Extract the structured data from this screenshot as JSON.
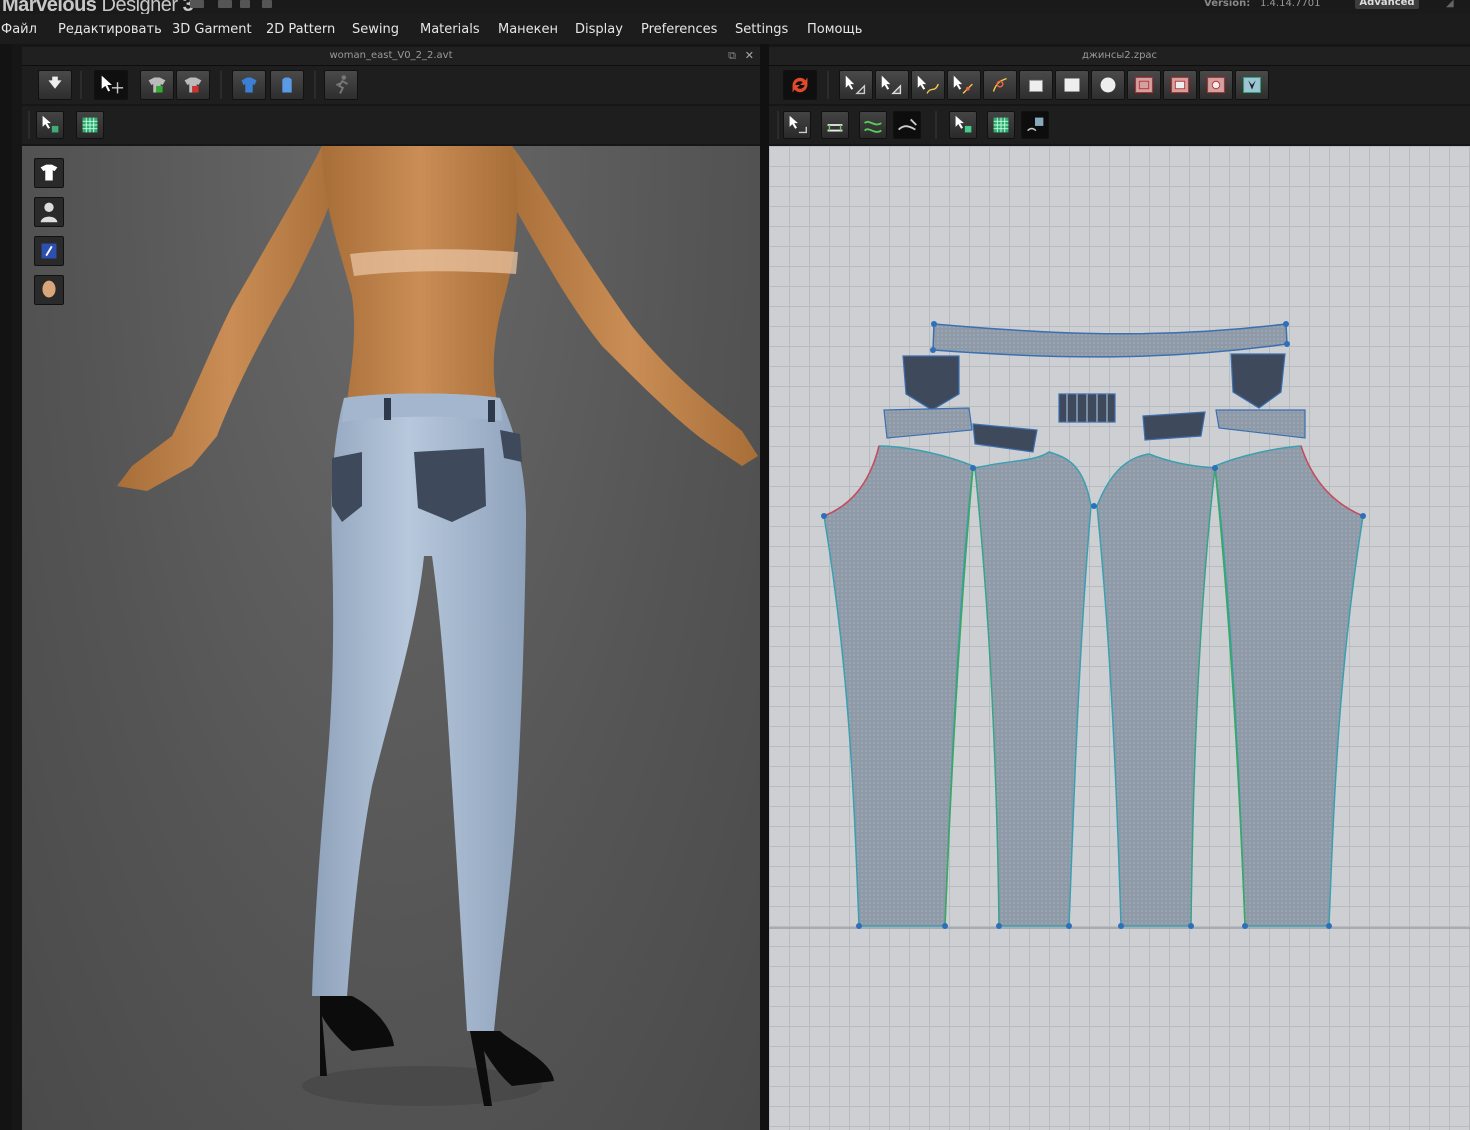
{
  "app": {
    "name_part1": "Marvelous",
    "name_part2": "Designer",
    "name_part3": "3",
    "version_label": "Version:",
    "version_value": "1.4.14.7701",
    "edition": "Advanced"
  },
  "menu": [
    "Файл",
    "Редактировать",
    "3D Garment",
    "2D Pattern",
    "Sewing",
    "Materials",
    "Манекен",
    "Display",
    "Preferences",
    "Settings",
    "Помощь"
  ],
  "left_panel": {
    "title": "woman_east_V0_2_2.avt",
    "toolbar_icons": [
      "down-arrow-icon",
      "select-move-icon",
      "garment-simulate-icon",
      "garment-reset-icon",
      "shirt-blue-icon",
      "shirt-flat-icon",
      "run-pose-icon"
    ],
    "secondary_icons": [
      "select-pin-icon",
      "texture-grid-icon"
    ],
    "side_icons": [
      "garment-visibility-icon",
      "avatar-visibility-icon",
      "fabric-visibility-icon",
      "avatar-head-icon"
    ]
  },
  "right_panel": {
    "title": "джинсы2.zpac",
    "toolbar_icons": [
      "sync-icon",
      "edit-pattern-icon",
      "edit-point-icon",
      "edit-curve-icon",
      "add-point-icon",
      "curve-point-icon",
      "polygon-icon",
      "rectangle-icon",
      "circle-icon",
      "internal-polygon-icon",
      "internal-rectangle-icon",
      "internal-circle-icon",
      "dart-icon"
    ],
    "secondary_icons": [
      "edit-sewing-icon",
      "segment-sewing-icon",
      "free-sewing-icon",
      "sewing-visibility-icon",
      "edit-texture-icon",
      "texture-grid-icon",
      "texture-visibility-icon"
    ]
  },
  "colors": {
    "denim_light": "#a9bdd4",
    "denim_dark": "#3e4a5c",
    "pattern_fill": "#8e9aa7",
    "grid_bg": "#cdcfd3",
    "sync_red": "#e04a2a"
  }
}
